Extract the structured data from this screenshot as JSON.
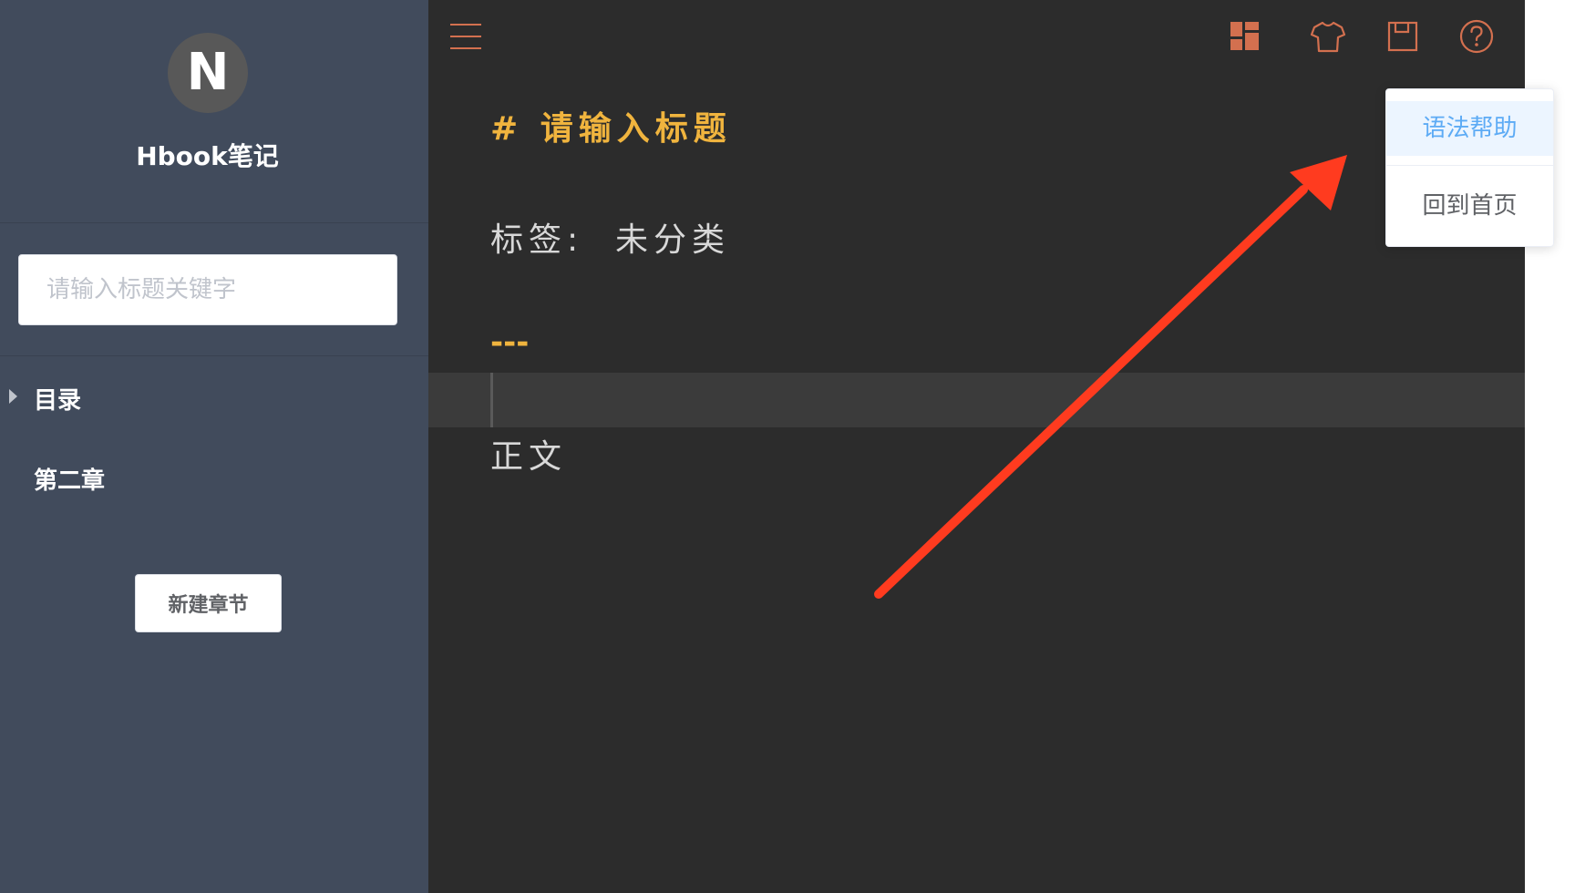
{
  "sidebar": {
    "logo_letter": "N",
    "app_name": "Hbook笔记",
    "search": {
      "placeholder": "请输入标题关键字",
      "value": ""
    },
    "tree": [
      {
        "label": "目录",
        "expandable": true
      },
      {
        "label": "第二章",
        "expandable": false
      }
    ],
    "new_chapter_label": "新建章节"
  },
  "toolbar": {
    "icons": [
      "menu-icon",
      "layout-icon",
      "theme-shirt-icon",
      "save-icon",
      "help-icon"
    ],
    "icon_color": "#d3704f"
  },
  "editor": {
    "heading_line": "# 请输入标题",
    "tag_line": "标签:  未分类",
    "rule_line": "---",
    "body_line": "正文",
    "heading_color": "#f0b43e",
    "text_color": "#d8d8d8",
    "background": "#2c2c2c"
  },
  "dropdown": {
    "items": [
      {
        "label": "语法帮助",
        "active": true
      },
      {
        "label": "回到首页",
        "active": false
      }
    ],
    "active_color": "#5dabf5"
  },
  "colors": {
    "sidebar_bg": "#414b5c",
    "annotation_arrow": "#ff3b1f"
  }
}
